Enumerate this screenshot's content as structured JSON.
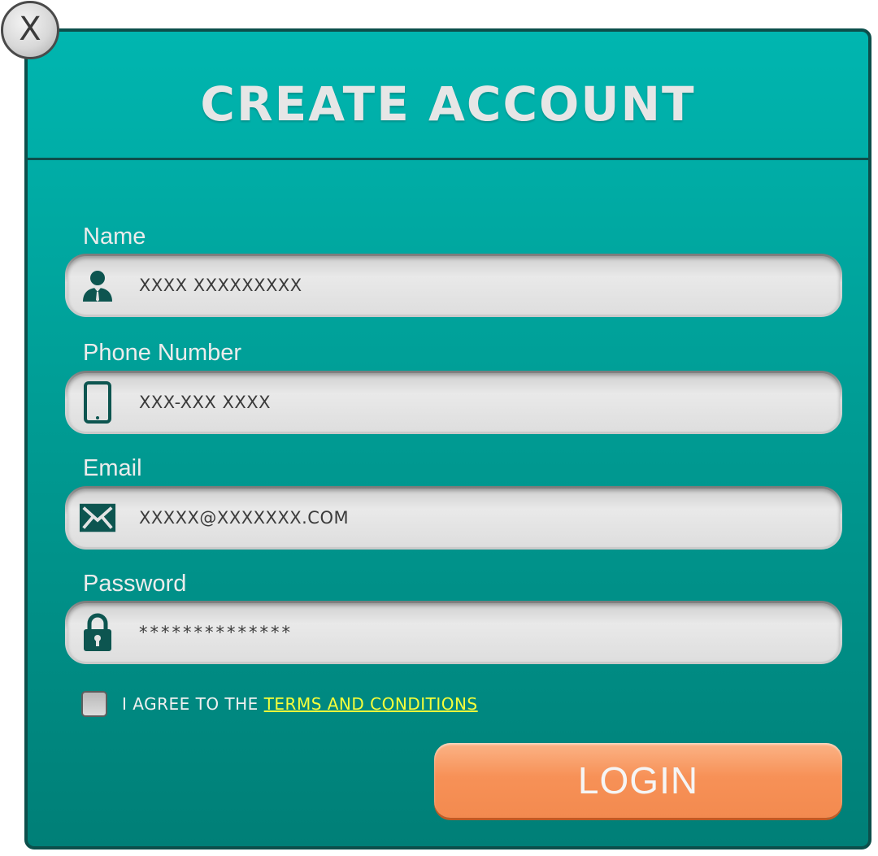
{
  "dialog": {
    "close_label": "X",
    "title": "CREATE ACCOUNT"
  },
  "fields": {
    "name": {
      "label": "Name",
      "value": "XXXX XXXXXXXXX",
      "icon": "user-icon"
    },
    "phone": {
      "label": "Phone  Number",
      "value": "XXX-XXX XXXX",
      "icon": "mobile-phone-icon"
    },
    "email": {
      "label": "Email",
      "value": "XXXXX@XXXXXXX.COM",
      "icon": "envelope-icon"
    },
    "password": {
      "label": "Password",
      "value": "**************",
      "icon": "padlock-icon"
    }
  },
  "agreement": {
    "prefix": "I AGREE TO THE ",
    "link": "TERMS AND CONDITIONS",
    "checked": false
  },
  "actions": {
    "login_label": "LOGIN"
  },
  "colors": {
    "panel_top": "#00b6b0",
    "panel_bottom": "#007f77",
    "icon": "#0d5550",
    "link": "#f6ff3a",
    "button": "#f79157"
  }
}
